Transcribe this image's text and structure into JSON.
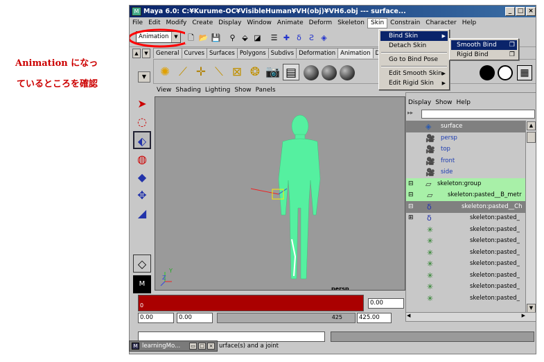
{
  "annotation": {
    "line1": "Animation になっ",
    "line2": "ているところを確認"
  },
  "window": {
    "title": "Maya 6.0: C:¥Kurume-OC¥VisibleHuman¥VH(obj)¥VH6.obj   ---   surface...",
    "min_label": "_",
    "max_label": "□",
    "close_label": "×"
  },
  "menubar": [
    "File",
    "Edit",
    "Modify",
    "Create",
    "Display",
    "Window",
    "Animate",
    "Deform",
    "Skeleton",
    "Skin",
    "Constrain",
    "Character",
    "Help"
  ],
  "menu_set": {
    "value": "Animation",
    "arrow": "▼"
  },
  "shelf_tabs": [
    "General",
    "Curves",
    "Surfaces",
    "Polygons",
    "Subdivs",
    "Deformation",
    "Animation",
    "D"
  ],
  "viewport": {
    "menu": [
      "View",
      "Shading",
      "Lighting",
      "Show",
      "Panels"
    ],
    "camera": "persp",
    "axis_y": "Y",
    "axis_z": "Z",
    "axis_x": "X"
  },
  "skin_menu": {
    "items": [
      "Bind Skin",
      "Detach Skin",
      "Go to Bind Pose",
      "Edit Smooth Skin",
      "Edit Rigid Skin"
    ],
    "submenu_arrow": "▶"
  },
  "bind_submenu": {
    "items": [
      "Smooth Bind",
      "Rigid Bind"
    ],
    "option_icon": "❐"
  },
  "outliner": {
    "menu": [
      "Display",
      "Show",
      "Help"
    ],
    "rows": [
      {
        "label": "surface",
        "icon": "surface-icon"
      },
      {
        "label": "persp",
        "icon": "camera-icon"
      },
      {
        "label": "top",
        "icon": "camera-icon"
      },
      {
        "label": "front",
        "icon": "camera-icon"
      },
      {
        "label": "side",
        "icon": "camera-icon"
      },
      {
        "label": "skeleton:group",
        "icon": "group-icon",
        "expander": "⊟"
      },
      {
        "label": "skeleton:pasted__B_metr",
        "icon": "group-icon",
        "expander": "⊟"
      },
      {
        "label": "skeleton:pasted__Ch",
        "icon": "joint-icon",
        "expander": "⊟"
      },
      {
        "label": "skeleton:pasted_",
        "icon": "joint-icon",
        "expander": "⊞"
      },
      {
        "label": "skeleton:pasted_",
        "icon": "cluster-icon"
      },
      {
        "label": "skeleton:pasted_",
        "icon": "cluster-icon"
      },
      {
        "label": "skeleton:pasted_",
        "icon": "cluster-icon"
      },
      {
        "label": "skeleton:pasted_",
        "icon": "cluster-icon"
      },
      {
        "label": "skeleton:pasted_",
        "icon": "cluster-icon"
      },
      {
        "label": "skeleton:pasted_",
        "icon": "cluster-icon"
      },
      {
        "label": "skeleton:pasted_",
        "icon": "cluster-icon"
      }
    ]
  },
  "time": {
    "current": "0.00",
    "start": "0.00",
    "start2": "0.00",
    "range_start": "0.00",
    "range_end": "425.00",
    "slider_value": "425",
    "timeline_tick": "0"
  },
  "status": {
    "message": "urface(s) and a joint"
  },
  "taskbar": {
    "label": "learningMo..."
  },
  "colors": {
    "annotation": "#cc0000",
    "highlight": "#0a246a",
    "mesh": "#55f0a0",
    "timeline": "#aa0000",
    "selected_row": "#a0f0a0"
  }
}
